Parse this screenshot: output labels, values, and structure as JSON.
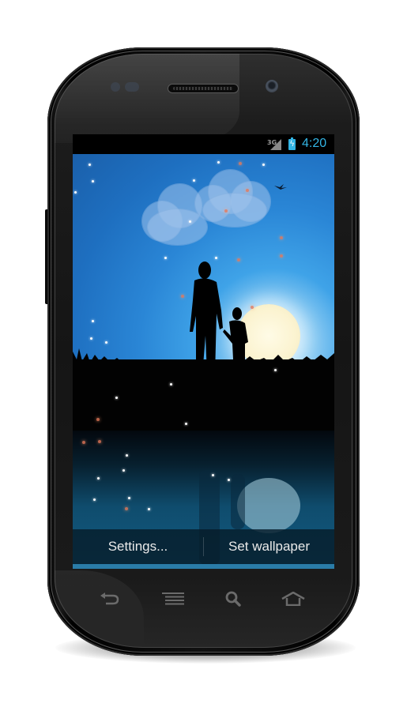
{
  "device": {
    "model_type": "android-phone",
    "status_bar": {
      "network": "3G",
      "battery_state": "charging",
      "time": "4:20",
      "accent_color": "#33b5e5"
    }
  },
  "wallpaper_preview": {
    "scene": "Father and son silhouette at night with moon and clouds",
    "actions": {
      "settings_label": "Settings...",
      "set_wallpaper_label": "Set wallpaper"
    }
  },
  "nav_buttons": [
    {
      "name": "back",
      "icon": "back-arrow-icon"
    },
    {
      "name": "menu",
      "icon": "menu-lines-icon"
    },
    {
      "name": "search",
      "icon": "search-icon"
    },
    {
      "name": "home",
      "icon": "home-icon"
    }
  ]
}
